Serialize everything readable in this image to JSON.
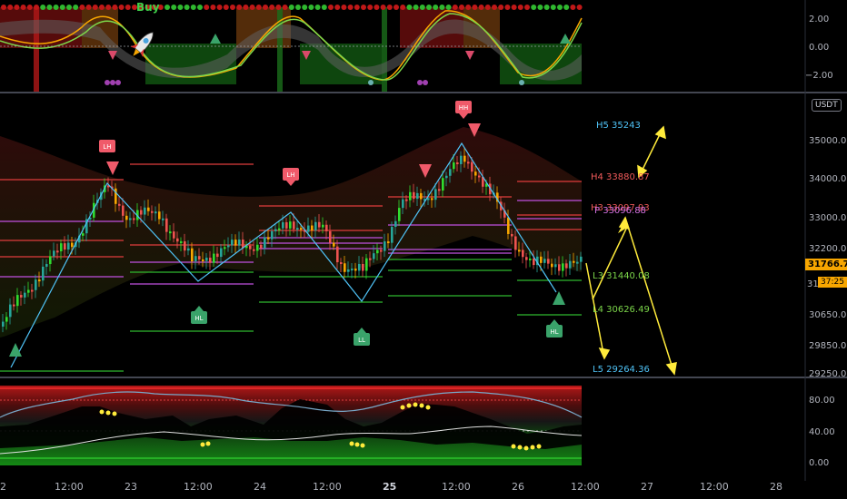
{
  "top_panel": {
    "buy_label": "Buy",
    "axis": [
      "2.00",
      "0.00",
      "−2.00"
    ]
  },
  "main_panel": {
    "currency_badge": "USDT",
    "price_axis": [
      "35000.00",
      "34000.00",
      "33000.00",
      "32200.00",
      "30650.00",
      "29850.00",
      "29250.00"
    ],
    "partial_axis": [
      "3",
      "314"
    ],
    "current_price": "31766.71",
    "countdown": "37:25",
    "pivot_labels": [
      "H5 35243",
      "H4 33880.87",
      "H3 33097.93",
      "P 33096.88",
      "L3 31440.08",
      "L4 30626.49",
      "L5 29264.36"
    ],
    "swing_labels": [
      "LH",
      "LH",
      "HL",
      "LL",
      "HH",
      "HL"
    ]
  },
  "bottom_panel": {
    "axis": [
      "80.00",
      "40.00",
      "0.00"
    ]
  },
  "time_axis": [
    "2",
    "12:00",
    "23",
    "12:00",
    "24",
    "12:00",
    "25",
    "12:00",
    "26",
    "12:00",
    "27",
    "12:00",
    "28"
  ],
  "colors": {
    "up": "#26a69a",
    "up_bright": "#2fdc2f",
    "down": "#ef5350",
    "orange": "#f7a600",
    "pivot_high": "#e03c3c",
    "pivot_mid": "#c050e0",
    "pivot_low": "#2fb82f",
    "zigzag": "#4fc3f7",
    "projection": "#ffeb3b"
  }
}
